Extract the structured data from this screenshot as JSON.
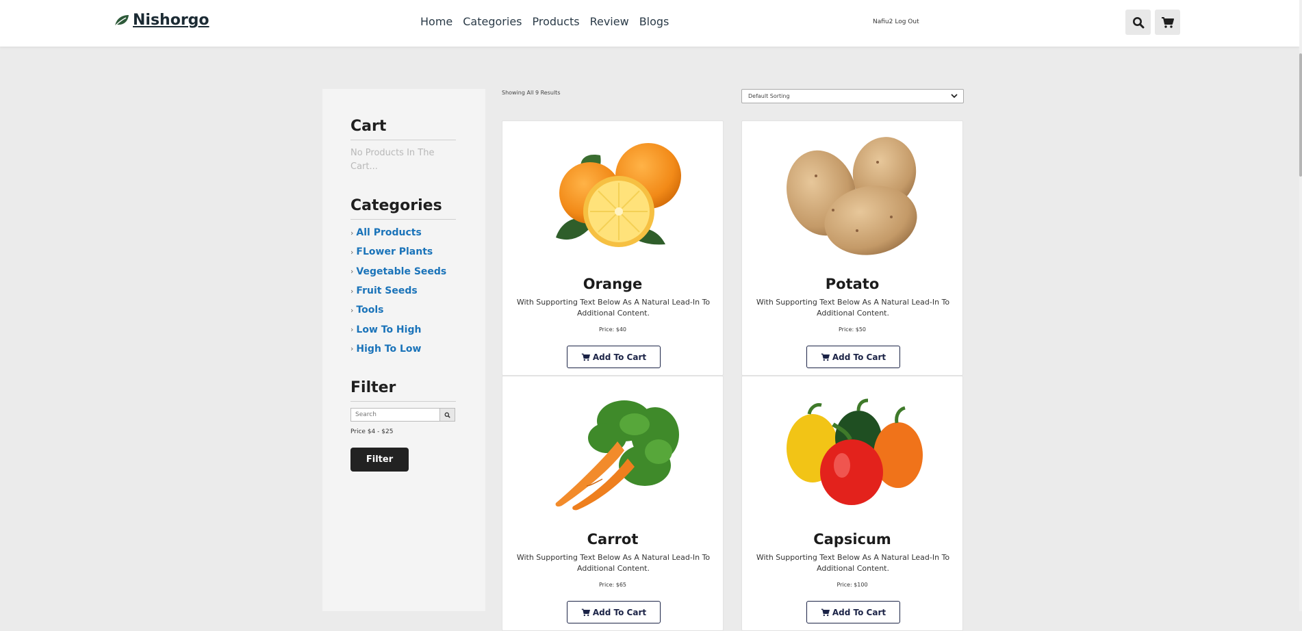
{
  "header": {
    "brand": "Nishorgo",
    "nav": [
      "Home",
      "Categories",
      "Products",
      "Review",
      "Blogs"
    ],
    "user": "Nafiu2",
    "logout": "Log Out"
  },
  "sidebar": {
    "cart_title": "Cart",
    "cart_empty": "No Products In The Cart...",
    "categories_title": "Categories",
    "categories": [
      "All Products",
      "FLower Plants",
      "Vegetable Seeds",
      "Fruit Seeds",
      "Tools",
      "Low To High",
      "High To Low"
    ],
    "filter_title": "Filter",
    "search_placeholder": "Search",
    "price_range": "Price $4 - $25",
    "filter_button": "Filter"
  },
  "results": "Showing All 9 Results",
  "sort": "Default Sorting",
  "products": [
    {
      "name": "Orange",
      "desc": "With Supporting Text Below As A Natural Lead-In To Additional Content.",
      "price": "Price: $40",
      "button": "Add To Cart"
    },
    {
      "name": "Potato",
      "desc": "With Supporting Text Below As A Natural Lead-In To Additional Content.",
      "price": "Price: $50",
      "button": "Add To Cart"
    },
    {
      "name": "Carrot",
      "desc": "With Supporting Text Below As A Natural Lead-In To Additional Content.",
      "price": "Price: $65",
      "button": "Add To Cart"
    },
    {
      "name": "Capsicum",
      "desc": "With Supporting Text Below As A Natural Lead-In To Additional Content.",
      "price": "Price: $100",
      "button": "Add To Cart"
    }
  ],
  "colors": {
    "accent_link": "#1a73b9",
    "dark_button": "#222222",
    "brand_leaf": "#2e5a3a",
    "page_bg": "#ebebeb"
  }
}
